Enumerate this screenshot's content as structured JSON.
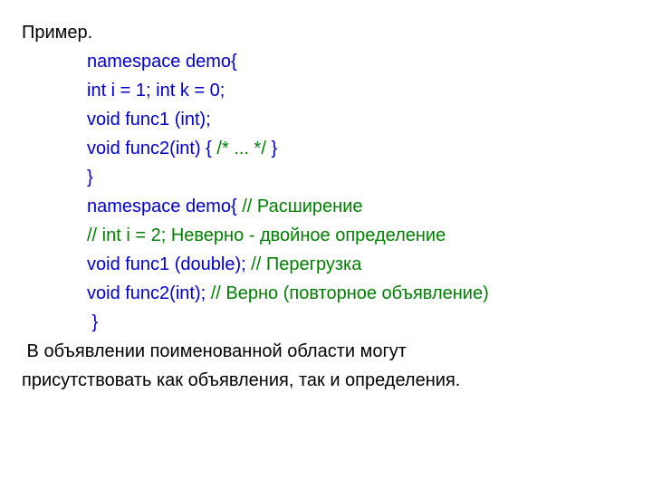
{
  "l0": "Пример.",
  "l1": "namespace demo{",
  "l2a": "int i = 1; int k = 0;",
  "l3a": "void func1 (int);",
  "l4a": "void func2(int) { ",
  "l4b": "/* ... */",
  "l4c": " }",
  "l5": "}",
  "l6a": "namespace demo{ ",
  "l6b": "// Расширение",
  "l7a": "// int i = 2; Неверно - двойное определение",
  "l8a": "void func1 (double); ",
  "l8b": "// Перегрузка",
  "l9a": "void func2(int); ",
  "l9b": "// Верно (повторное объявление)",
  "l10": " }",
  "p1": " В объявлении поименованной области могут",
  "p2": "присутствовать как объявления, так и определения."
}
